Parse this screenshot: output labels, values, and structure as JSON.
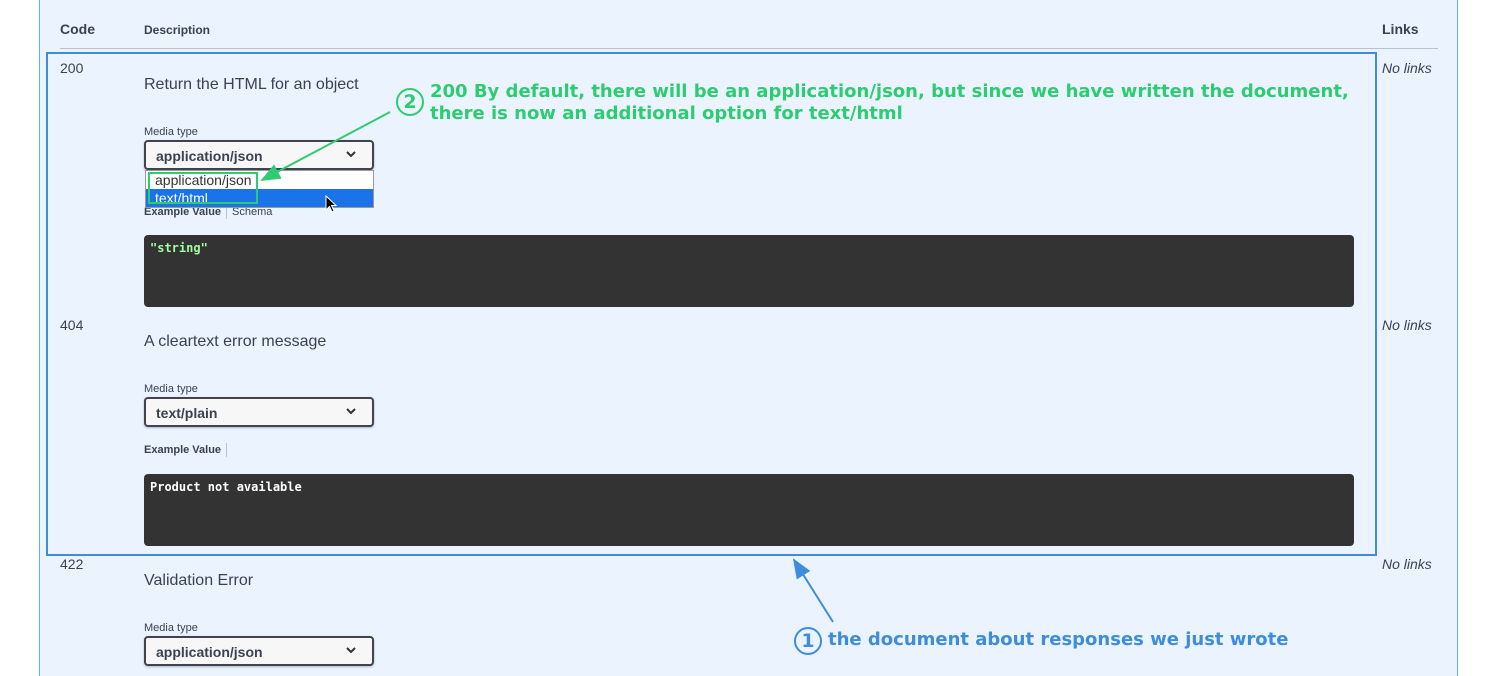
{
  "table": {
    "headers": {
      "code": "Code",
      "description": "Description",
      "links": "Links"
    }
  },
  "responses": [
    {
      "code": "200",
      "description": "Return the HTML for an object",
      "media_type_label": "Media type",
      "media_type": "application/json",
      "dropdown_options": [
        "application/json",
        "text/html"
      ],
      "dropdown_selected_option": "text/html",
      "example_tabs": [
        "Example Value",
        "Schema"
      ],
      "example_value": "\"string\"",
      "links": "No links"
    },
    {
      "code": "404",
      "description": "A cleartext error message",
      "media_type_label": "Media type",
      "media_type": "text/plain",
      "example_tabs": [
        "Example Value"
      ],
      "example_value": "Product not available",
      "links": "No links"
    },
    {
      "code": "422",
      "description": "Validation Error",
      "media_type_label": "Media type",
      "media_type": "application/json",
      "links": "No links"
    }
  ],
  "annotations": {
    "note_1": {
      "number": "1",
      "text": "the document about responses we just wrote",
      "color": "#3d8ddc"
    },
    "note_2": {
      "number": "2",
      "line1": "200 By default, there will be an application/json, but since we have written the document,",
      "line2": "there is now an additional option for text/html",
      "color": "#2ecc71"
    }
  },
  "colors": {
    "panel_bg": "#ebf3fe",
    "panel_border": "#61affe",
    "code_bg": "#333333",
    "string_green": "#a2fca2",
    "selected_option": "#1a73e8"
  }
}
